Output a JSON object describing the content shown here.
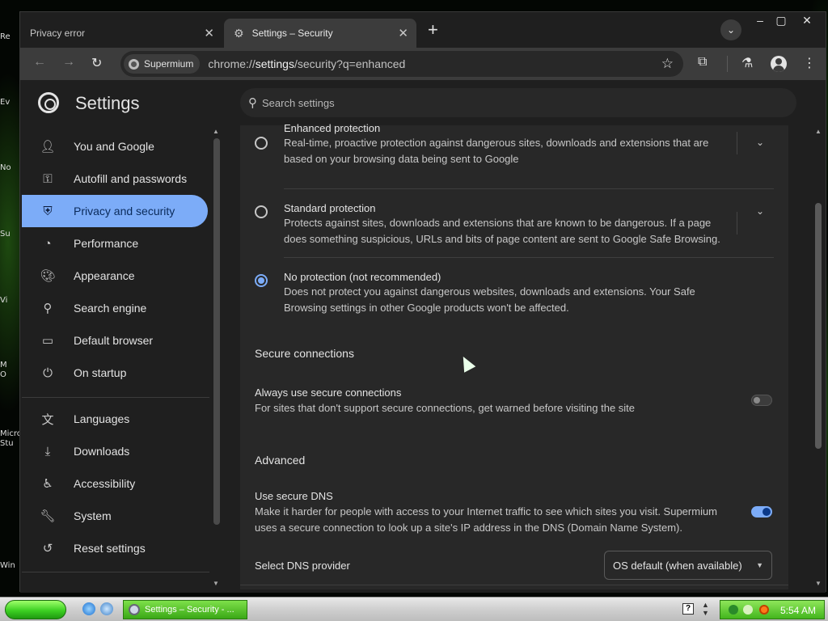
{
  "desktop": {
    "icon_labels": [
      "Re",
      "Ev",
      "No",
      "Su",
      "Vi",
      "M\nO",
      "Micro\nStu",
      "Win"
    ]
  },
  "tabs": [
    {
      "label": "Privacy error",
      "active": false
    },
    {
      "label": "Settings – Security",
      "active": true
    }
  ],
  "toolbar": {
    "chip_label": "Supermium",
    "url_prefix": "chrome://",
    "url_host": "settings",
    "url_path": "/security?q=enhanced"
  },
  "header": {
    "title": "Settings",
    "search_placeholder": "Search settings"
  },
  "sidebar": {
    "items": [
      {
        "label": "You and Google",
        "icon": "person-icon"
      },
      {
        "label": "Autofill and passwords",
        "icon": "key-icon"
      },
      {
        "label": "Privacy and security",
        "icon": "shield-icon",
        "active": true
      },
      {
        "label": "Performance",
        "icon": "speedometer-icon"
      },
      {
        "label": "Appearance",
        "icon": "palette-icon"
      },
      {
        "label": "Search engine",
        "icon": "search-icon"
      },
      {
        "label": "Default browser",
        "icon": "browser-window-icon"
      },
      {
        "label": "On startup",
        "icon": "power-icon"
      },
      {
        "label": "Languages",
        "icon": "translate-icon"
      },
      {
        "label": "Downloads",
        "icon": "download-icon"
      },
      {
        "label": "Accessibility",
        "icon": "accessibility-icon"
      },
      {
        "label": "System",
        "icon": "wrench-icon"
      },
      {
        "label": "Reset settings",
        "icon": "reset-icon"
      }
    ]
  },
  "safe_browsing": {
    "options": [
      {
        "title": "Enhanced protection",
        "description": "Real-time, proactive protection against dangerous sites, downloads and extensions that are based on your browsing data being sent to Google",
        "checked": false,
        "expandable": true
      },
      {
        "title": "Standard protection",
        "description": "Protects against sites, downloads and extensions that are known to be dangerous. If a page does something suspicious, URLs and bits of page content are sent to Google Safe Browsing.",
        "checked": false,
        "expandable": true
      },
      {
        "title": "No protection (not recommended)",
        "description": "Does not protect you against dangerous websites, downloads and extensions. Your Safe Browsing settings in other Google products won't be affected.",
        "checked": true,
        "expandable": false
      }
    ]
  },
  "secure_connections": {
    "heading": "Secure connections",
    "title": "Always use secure connections",
    "description": "For sites that don't support secure connections, get warned before visiting the site",
    "enabled": false
  },
  "advanced": {
    "heading": "Advanced",
    "dns_title": "Use secure DNS",
    "dns_description": "Make it harder for people with access to your Internet traffic to see which sites you visit. Supermium uses a secure connection to look up a site's IP address in the DNS (Domain Name System).",
    "dns_enabled": true,
    "provider_label": "Select DNS provider",
    "provider_value": "OS default (when available)"
  },
  "taskbar": {
    "task_label": "Settings – Security - ...",
    "clock": "5:54 AM"
  },
  "colors": {
    "accent": "#7cacf8",
    "surface": "#282828",
    "background": "#1f1f1f",
    "taskbar_green": "#43b51d"
  }
}
